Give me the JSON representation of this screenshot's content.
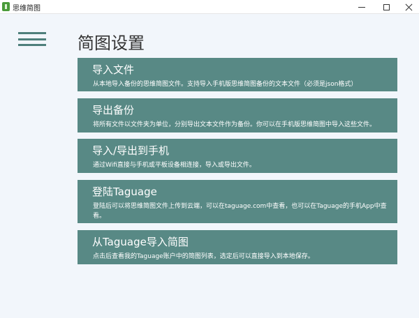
{
  "window": {
    "title": "思维简图"
  },
  "page": {
    "title": "简图设置"
  },
  "cards": [
    {
      "title": "导入文件",
      "description": "从本地导入备份的思维简图文件。支持导入手机版思维简图备份的文本文件（必须是json格式）"
    },
    {
      "title": "导出备份",
      "description": "将所有文件以文件夹为单位，分别导出文本文件作为备份。你可以在手机版思维简图中导入这些文件。"
    },
    {
      "title": "导入/导出到手机",
      "description": "通过Wifi直接与手机或平板设备相连接，导入或导出文件。"
    },
    {
      "title": "登陆Taguage",
      "description": "登陆后可以将思维简图文件上传到云端，可以在taguage.com中查看，也可以在Taguage的手机App中查看。"
    },
    {
      "title": "从Taguage导入简图",
      "description": "点击后查看我的Taguage账户中的简图列表，选定后可以直接导入到本地保存。"
    }
  ],
  "colors": {
    "card_background": "#588985",
    "menu_icon": "#4e7f7b",
    "page_background": "#f2f6fb"
  },
  "icons": {
    "app": "app-logo-icon",
    "menu": "hamburger-menu-icon",
    "minimize": "minimize-icon",
    "maximize": "maximize-icon",
    "close": "close-icon"
  }
}
